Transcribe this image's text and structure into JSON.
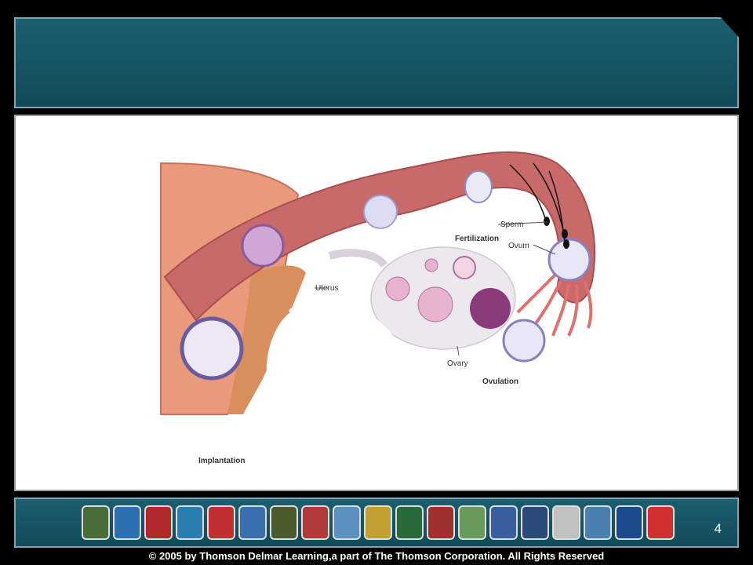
{
  "diagram": {
    "labels": {
      "sperm": "Sperm",
      "fertilization": "Fertilization",
      "ovum": "Ovum",
      "uterus": "Uterus",
      "ovary": "Ovary",
      "ovulation": "Ovulation",
      "implantation": "Implantation"
    }
  },
  "footer": {
    "page_number": "4",
    "badge_colors": [
      "#4a6b3a",
      "#2a6fb0",
      "#b02a2a",
      "#2a7fb0",
      "#c03030",
      "#3a6fb0",
      "#4a5a2a",
      "#b03a3a",
      "#5a8fc0",
      "#c0a030",
      "#2a6a3a",
      "#a03030",
      "#6a9a5a",
      "#3a5fa0",
      "#2a4a7a",
      "#c0c0c0",
      "#4a7fb0",
      "#1a4a8a",
      "#d03030"
    ]
  },
  "copyright": "© 2005 by Thomson Delmar Learning,a part of The Thomson Corporation. All Rights Reserved"
}
